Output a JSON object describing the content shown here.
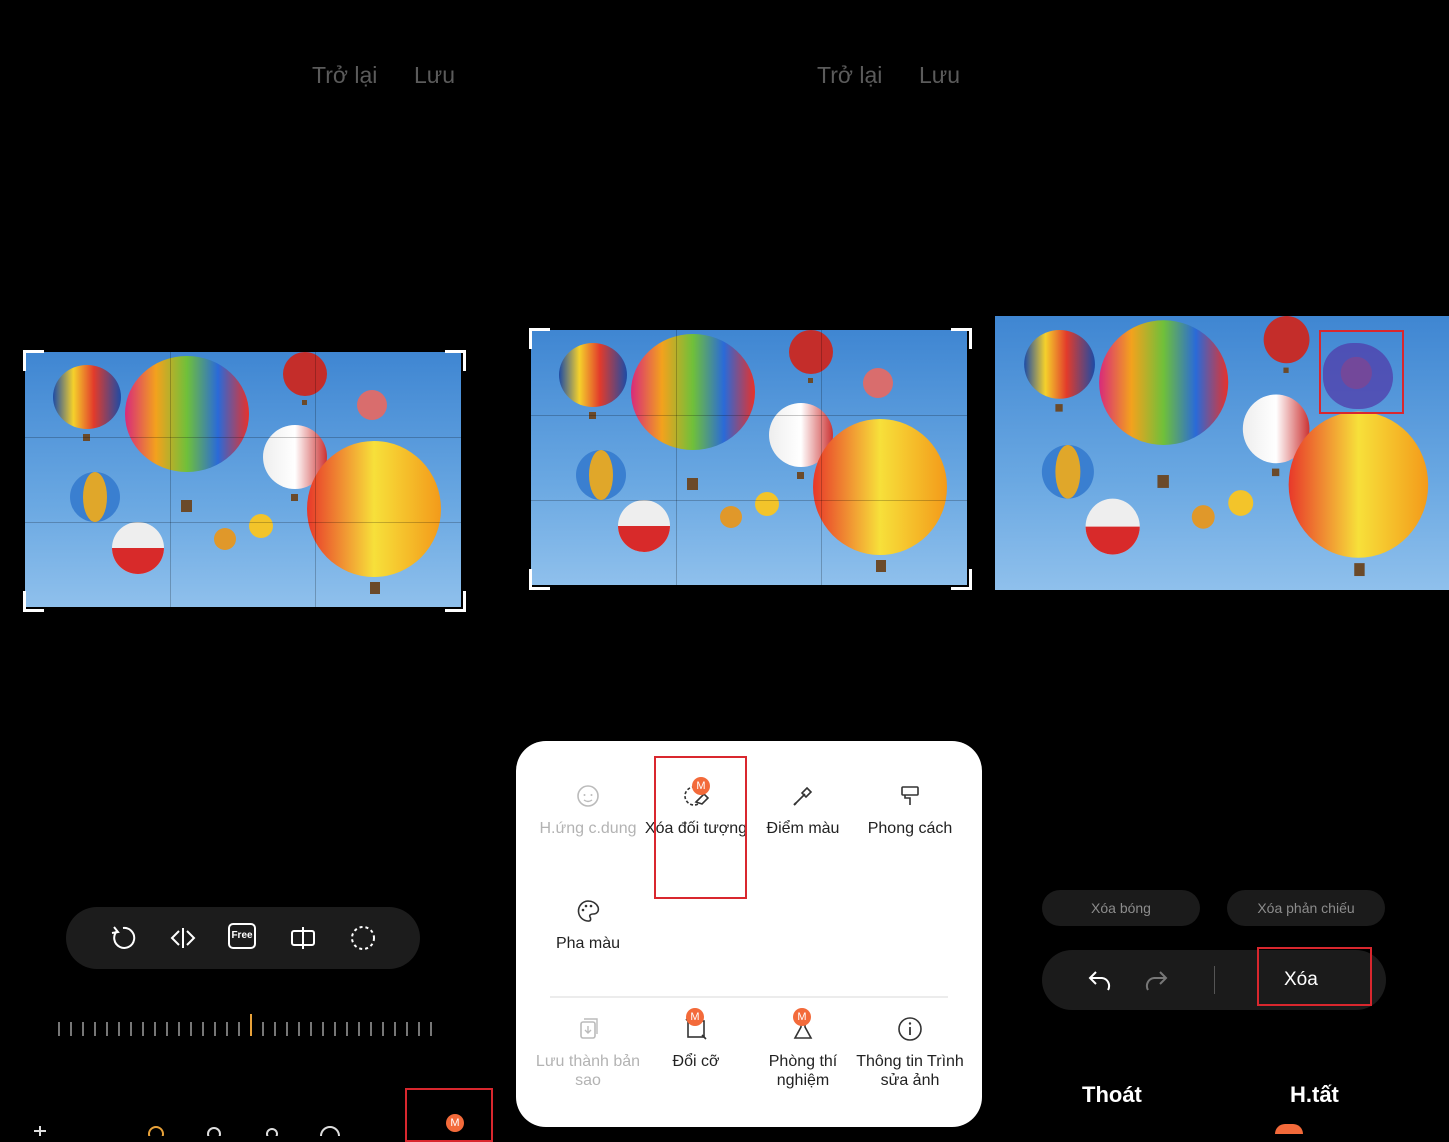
{
  "panel1": {
    "back_label": "Trở lại",
    "save_label": "Lưu",
    "toolbar_icons": [
      "rotate-icon",
      "flip-icon",
      "free-ratio-icon",
      "mirror-icon",
      "lasso-icon"
    ],
    "free_label": "Free",
    "badge_label": "M"
  },
  "panel2": {
    "back_label": "Trở lại",
    "save_label": "Lưu",
    "menu": [
      {
        "label": "H.ứng c.dung",
        "icon": "face-icon",
        "enabled": false
      },
      {
        "label": "Xóa đối tượng",
        "icon": "object-eraser-icon",
        "badge": "M",
        "enabled": true,
        "highlighted": true
      },
      {
        "label": "Điểm màu",
        "icon": "eyedropper-icon",
        "enabled": true
      },
      {
        "label": "Phong cách",
        "icon": "paintbrush-icon",
        "enabled": true
      },
      {
        "label": "Pha màu",
        "icon": "palette-icon",
        "enabled": true
      }
    ],
    "menu2": [
      {
        "label": "Lưu thành bản sao",
        "icon": "save-copy-icon",
        "enabled": false
      },
      {
        "label": "Đổi cỡ",
        "icon": "resize-icon",
        "badge": "M",
        "enabled": true
      },
      {
        "label": "Phòng thí nghiệm",
        "icon": "lab-flask-icon",
        "badge": "M",
        "enabled": true
      },
      {
        "label": "Thông tin Trình sửa ảnh",
        "icon": "info-icon",
        "enabled": true
      }
    ]
  },
  "panel3": {
    "remove_shadow": "Xóa bóng",
    "remove_reflection": "Xóa phản chiếu",
    "erase_label": "Xóa",
    "exit_label": "Thoát",
    "done_label": "H.tất"
  },
  "colors": {
    "accent_red": "#d9272e",
    "badge_orange": "#f36a3a",
    "sky_blue": "#4a8fd6"
  }
}
